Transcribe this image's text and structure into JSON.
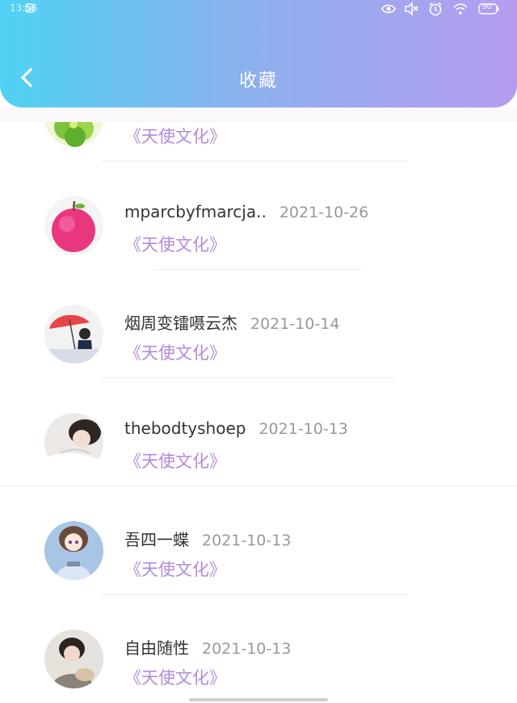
{
  "status_bar": {
    "time": "13:56",
    "battery": "90"
  },
  "nav": {
    "title": "收藏"
  },
  "items": [
    {
      "name": "",
      "date": "",
      "tag": "《天使文化》"
    },
    {
      "name": "mparcbyfmarcja..",
      "date": "2021-10-26",
      "tag": "《天使文化》"
    },
    {
      "name": "烟周变镭嗫云杰",
      "date": "2021-10-14",
      "tag": "《天使文化》"
    },
    {
      "name": "thebodtyshoep",
      "date": "2021-10-13",
      "tag": "《天使文化》"
    },
    {
      "name": "吾四一蝶",
      "date": "2021-10-13",
      "tag": "《天使文化》"
    },
    {
      "name": "自由随性",
      "date": "2021-10-13",
      "tag": "《天使文化》"
    }
  ],
  "colors": {
    "header_gradient_start": "#4fd2f3",
    "header_gradient_end": "#b59cee",
    "tag": "#b48ad8",
    "date": "#999999"
  }
}
